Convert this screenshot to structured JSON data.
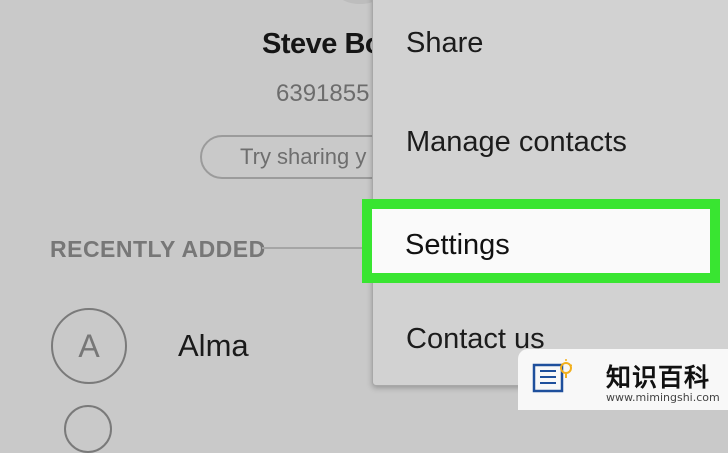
{
  "profile": {
    "name": "Steve Bo",
    "number": "6391855",
    "share_prompt": "Try sharing y"
  },
  "recently_added": {
    "header": "RECENTLY ADDED",
    "contacts": [
      {
        "initial": "A",
        "name": "Alma"
      }
    ]
  },
  "menu": {
    "items": [
      {
        "label": "Share"
      },
      {
        "label": "Manage contacts"
      },
      {
        "label": "Settings",
        "highlighted": true
      },
      {
        "label": "Contact us"
      }
    ]
  },
  "highlight_color": "#39e531",
  "watermark": {
    "title": "知识百科",
    "url": "www.mimingshi.com",
    "icon": "book-lightbulb-icon"
  }
}
